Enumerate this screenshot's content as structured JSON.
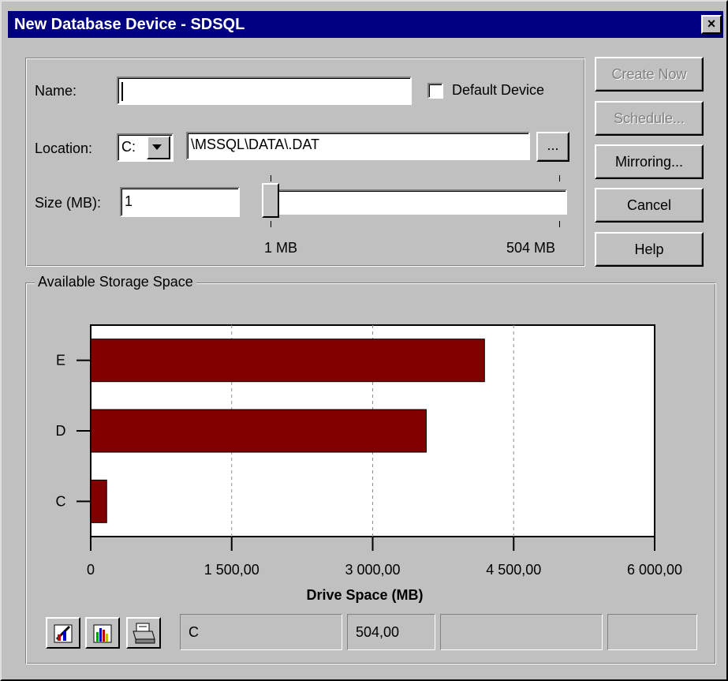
{
  "window": {
    "title": "New Database Device - SDSQL",
    "close_symbol": "×"
  },
  "form": {
    "name_label": "Name:",
    "name_value": "",
    "default_device_label": "Default Device",
    "default_device_checked": false,
    "location_label": "Location:",
    "drive_value": "C:",
    "path_value": "\\MSSQL\\DATA\\.DAT",
    "browse_label": "...",
    "size_label": "Size (MB):",
    "size_value": "1",
    "slider_value_mb": 1,
    "slider_min_label": "1 MB",
    "slider_max_label": "504 MB"
  },
  "buttons": {
    "create_now": "Create Now",
    "schedule": "Schedule...",
    "mirroring": "Mirroring...",
    "cancel": "Cancel",
    "help": "Help"
  },
  "storage": {
    "group_label": "Available Storage Space"
  },
  "chart_data": {
    "type": "bar",
    "orientation": "horizontal",
    "categories": [
      "C",
      "D",
      "E"
    ],
    "values": [
      170,
      3570,
      4190
    ],
    "xlabel": "Drive Space (MB)",
    "ylabel": "",
    "xlim": [
      0,
      6000
    ],
    "x_ticks": [
      0,
      1500,
      3000,
      4500,
      6000
    ],
    "x_tick_labels": [
      "0",
      "1 500,00",
      "3 000,00",
      "4 500,00",
      "6 000,00"
    ],
    "grid": "vertical dashed",
    "bar_color": "#800000"
  },
  "status_bar": {
    "drive": "C",
    "value": "504,00",
    "cell3": "",
    "cell4": ""
  },
  "icons": {
    "chart_wizard": "chart-wizard-icon",
    "chart_type": "bar-chart-icon",
    "print": "printer-icon"
  }
}
